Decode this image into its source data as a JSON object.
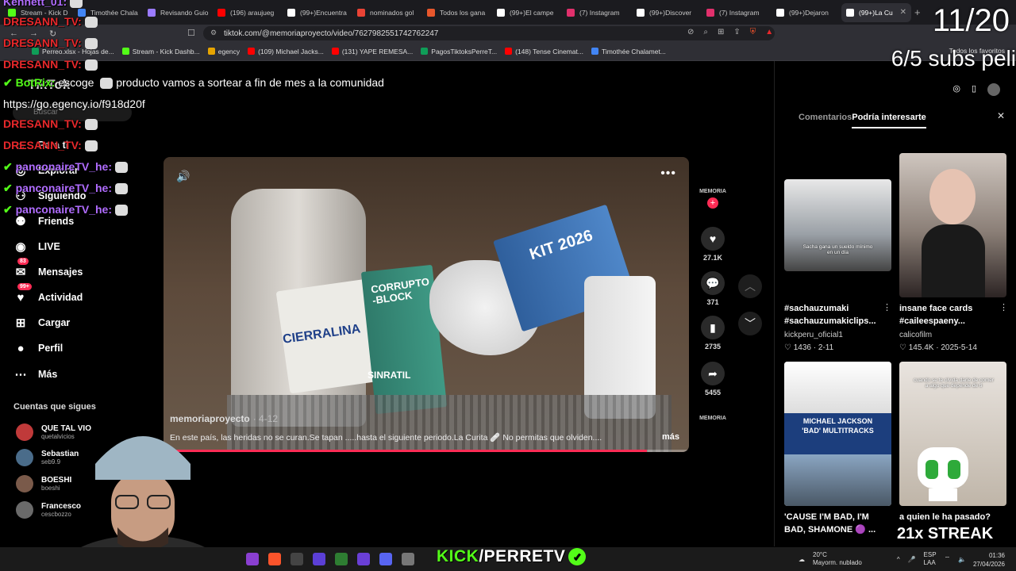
{
  "browser": {
    "tabs": [
      {
        "label": "Stream - Kick D",
        "color": "#53fc18"
      },
      {
        "label": "Timothée Chala",
        "color": "#4285f4"
      },
      {
        "label": "Revisando Guio",
        "color": "#9b7bff"
      },
      {
        "label": "(196) araujueg",
        "color": "#ff0000"
      },
      {
        "label": "(99+)Encuentra",
        "color": "#ffffff"
      },
      {
        "label": "nominados gol",
        "color": "#ea4335"
      },
      {
        "label": "Todos los gana",
        "color": "#e8572c"
      },
      {
        "label": "(99+)El campe",
        "color": "#ffffff"
      },
      {
        "label": "(7) Instagram",
        "color": "#e1306c"
      },
      {
        "label": "(99+)Discover",
        "color": "#ffffff"
      },
      {
        "label": "(7) Instagram",
        "color": "#e1306c"
      },
      {
        "label": "(99+)Dejaron",
        "color": "#ffffff"
      },
      {
        "label": "(99+)La Cu",
        "color": "#ffffff"
      }
    ],
    "url": "tiktok.com/@memoriaproyecto/video/7627982551742762247",
    "bookmarks": [
      {
        "label": "Perreo.xlsx - Hojas de...",
        "color": "#0f9d58"
      },
      {
        "label": "Stream - Kick Dashb...",
        "color": "#53fc18"
      },
      {
        "label": "egency",
        "color": "#e6a400"
      },
      {
        "label": "(109) Michael Jacks...",
        "color": "#ff0000"
      },
      {
        "label": "(131) YAPE REMESA...",
        "color": "#ff0000"
      },
      {
        "label": "PagosTiktoksPerreT...",
        "color": "#0f9d58"
      },
      {
        "label": "(148) Tense Cinemat...",
        "color": "#ff0000"
      },
      {
        "label": "Timothée Chalamet...",
        "color": "#4285f4"
      }
    ],
    "bookmarks_right": "Todos los favoritos"
  },
  "chat": {
    "lines": [
      {
        "user": "Kennett_01:",
        "color": "#b06cff"
      },
      {
        "user": "DRESANN_TV:",
        "color": "#e8282b"
      },
      {
        "user": "DRESANN_TV:",
        "color": "#e8282b"
      },
      {
        "user": "DRESANN_TV:",
        "color": "#e8282b"
      },
      {
        "user": "DRESANN_TV:",
        "color": "#e8282b"
      },
      {
        "user": "DRESANN_TV:",
        "color": "#e8282b"
      },
      {
        "user": "panconaireTV_he:",
        "color": "#b06cff"
      },
      {
        "user": "panconaireTV_he:",
        "color": "#b06cff"
      },
      {
        "user": "panconaireTV_he:",
        "color": "#b06cff"
      }
    ],
    "bot_user": "BotRix:",
    "bot_msg_a": "escoge",
    "bot_msg_b": "producto vamos a sortear a fin de mes a la comunidad",
    "bot_link": "https://go.egency.io/f918d20f"
  },
  "sidebar": {
    "logo": "TikTok",
    "search_placeholder": "Buscar",
    "items": [
      {
        "label": "Para ti",
        "icon": "home-icon"
      },
      {
        "label": "Explorar",
        "icon": "compass-icon"
      },
      {
        "label": "Siguiendo",
        "icon": "following-icon"
      },
      {
        "label": "Friends",
        "icon": "friends-icon"
      },
      {
        "label": "LIVE",
        "icon": "live-icon"
      },
      {
        "label": "Mensajes",
        "icon": "messages-icon",
        "badge": "83"
      },
      {
        "label": "Actividad",
        "icon": "activity-icon",
        "badge": "99+"
      },
      {
        "label": "Cargar",
        "icon": "upload-icon"
      },
      {
        "label": "Perfil",
        "icon": "profile-icon"
      },
      {
        "label": "Más",
        "icon": "more-icon"
      }
    ],
    "following_title": "Cuentas que sigues",
    "following": [
      {
        "name": "QUE TAL VIO",
        "handle": "quetalvicios"
      },
      {
        "name": "Sebastian",
        "handle": "seb9.9"
      },
      {
        "name": "BOESHI",
        "handle": "boeshi"
      },
      {
        "name": "Francesco",
        "handle": "cescbozzo"
      }
    ]
  },
  "video": {
    "author": "memoriaproyecto",
    "date": "· 4-12",
    "description": "En este país, las heridas no se curan.Se tapan      .....hasta el siguiente periodo.La Curita 🩹 No permitas que olviden....",
    "more_label": "más",
    "progress": 0.92,
    "texts": {
      "cierralina": "CIERRALINA",
      "corrupto": "CORRUPTO -BLOCK",
      "sinratil": "SINRATIL",
      "kit": "KIT 2026"
    }
  },
  "actions": {
    "profile_label": "MEMORIA",
    "likes": "27.1K",
    "comments": "371",
    "saves": "2735",
    "shares": "5455",
    "music_label": "MEMORIA"
  },
  "rpanel": {
    "tabs": [
      "Comentarios",
      "Podría interesarte"
    ],
    "active_tab": 1,
    "cards": [
      {
        "title": "#sachauzumaki #sachauzumakiclips...",
        "author": "kickperu_oficial1",
        "likes": "1436",
        "date": "· 2-11",
        "thumb_text": "Sacha gana un sueldo mínimo en un día"
      },
      {
        "title": "insane face cards #caileespaeny...",
        "author": "calicofilm",
        "likes": "145.4K",
        "date": "· 2025-5-14",
        "thumb_text": ""
      },
      {
        "title": "'CAUSE I'M BAD, I'M BAD, SHAMONE 🟣 ...",
        "author": "",
        "likes": "",
        "date": "",
        "thumb_text": "MICHAEL JACKSON 'BAD' MULTITRACKS"
      },
      {
        "title": "a quien le ha pasado?",
        "author": "",
        "likes": "",
        "date": "",
        "thumb_text": "cuando se te olvida darle de comer a algo que depende de ti"
      }
    ]
  },
  "overlay": {
    "counter": "11/20",
    "subs": "6/5 subs peli",
    "streak": "21x STREAK",
    "kick_a": "KICK",
    "kick_b": "/PERRETV"
  },
  "taskbar": {
    "weather_temp": "20°C",
    "weather_desc": "Mayorm. nublado",
    "lang": "ESP",
    "region": "LAA",
    "time": "01:36",
    "date": "27/04/2026"
  }
}
